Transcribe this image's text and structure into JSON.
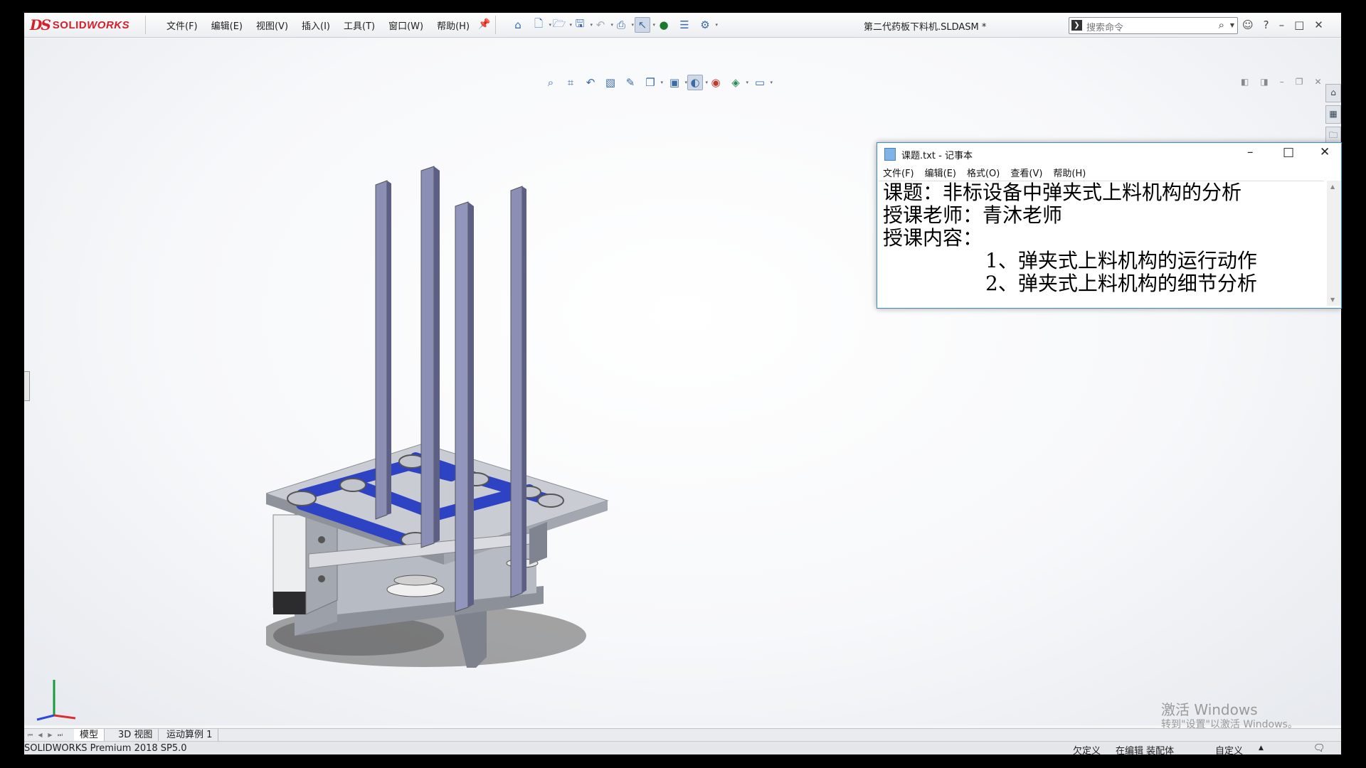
{
  "app": {
    "brand_ds": "DS",
    "brand_solid": "SOLID",
    "brand_works": "WORKS",
    "document_title": "第二代药板下料机.SLDASM *"
  },
  "menu": [
    "文件(F)",
    "编辑(E)",
    "视图(V)",
    "插入(I)",
    "工具(T)",
    "窗口(W)",
    "帮助(H)"
  ],
  "search": {
    "placeholder": "搜索命令"
  },
  "tabs": {
    "model": "模型",
    "view3d": "3D 视图",
    "motion": "运动算例 1"
  },
  "status": {
    "version": "SOLIDWORKS Premium 2018 SP5.0",
    "defined": "欠定义",
    "editing": "在编辑 装配体",
    "custom": "自定义"
  },
  "watermark": {
    "line1": "激活 Windows",
    "line2": "转到\"设置\"以激活 Windows。"
  },
  "notepad": {
    "title": "课题.txt - 记事本",
    "menu": [
      "文件(F)",
      "编辑(E)",
      "格式(O)",
      "查看(V)",
      "帮助(H)"
    ],
    "lines": [
      "课题：非标设备中弹夹式上料机构的分析",
      "授课老师：青沐老师",
      "授课内容：",
      "1、弹夹式上料机构的运行动作",
      "2、弹夹式上料机构的细节分析"
    ]
  },
  "colors": {
    "brand_red": "#d4202a",
    "belt_blue": "#2e42c4",
    "column_purple": "#8c8fb5",
    "frame_gray": "#a9adb6"
  },
  "icons": {
    "toolbar": [
      "home-icon",
      "new-icon",
      "open-icon",
      "save-icon",
      "undo-icon",
      "print-icon",
      "select-icon",
      "traffic-light-icon",
      "options-list-icon",
      "gear-icon"
    ],
    "hud": [
      "zoom-to-fit-icon",
      "zoom-area-icon",
      "previous-view-icon",
      "section-view-icon",
      "dynamic-annotation-icon",
      "view-orientation-icon",
      "display-style-icon",
      "hide-show-icon",
      "edit-appearance-icon",
      "apply-scene-icon",
      "view-settings-icon"
    ]
  }
}
